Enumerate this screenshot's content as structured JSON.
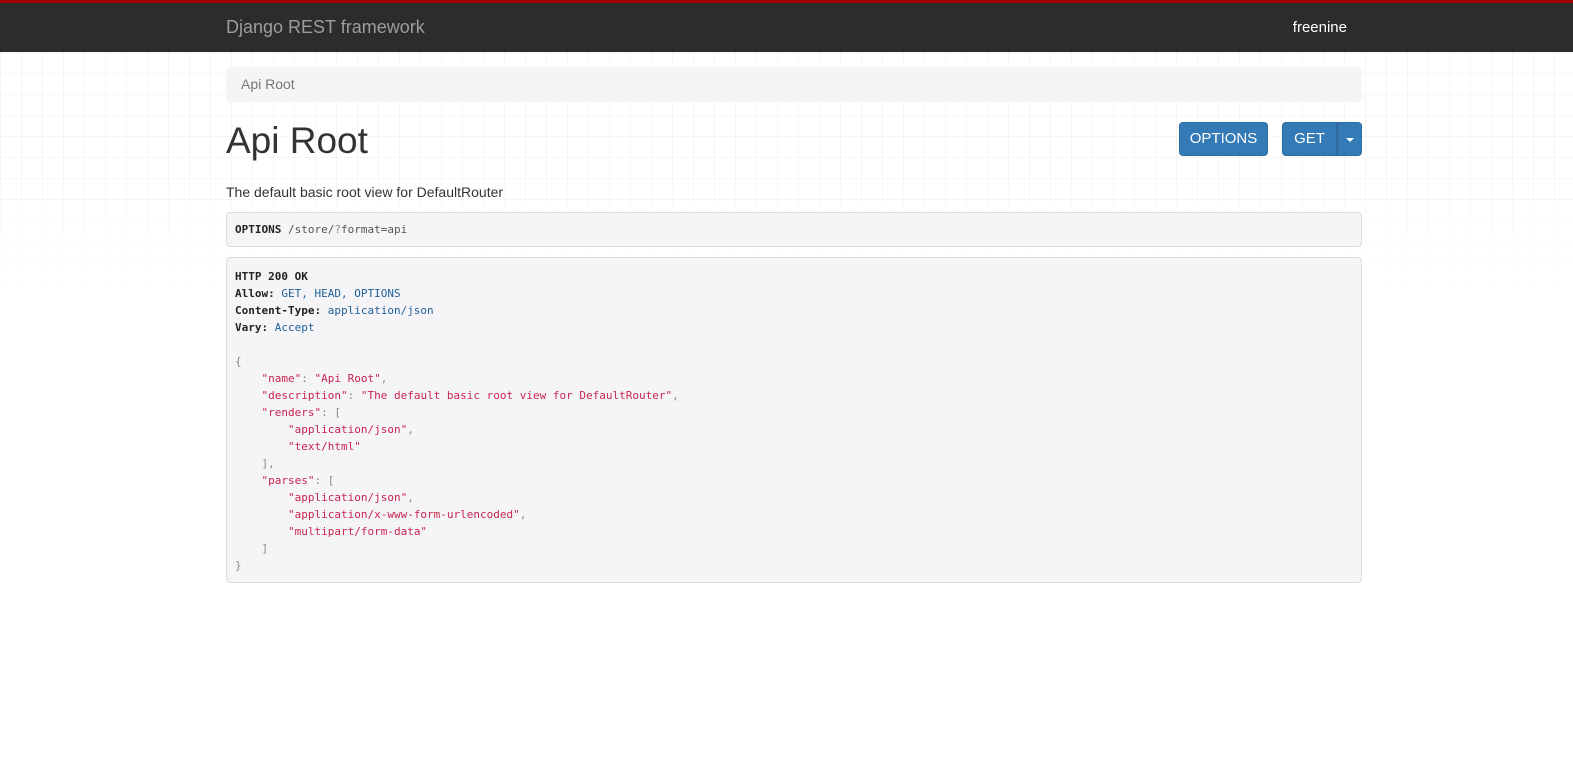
{
  "navbar": {
    "brand": "Django REST framework",
    "user": "freenine"
  },
  "breadcrumb": {
    "current": "Api Root"
  },
  "page": {
    "title": "Api Root",
    "description": "The default basic root view for DefaultRouter"
  },
  "actions": {
    "options_label": "OPTIONS",
    "get_label": "GET"
  },
  "request": {
    "method": "OPTIONS",
    "path": "/store/",
    "query_sep": "?",
    "query": "format=api"
  },
  "response": {
    "status": "HTTP 200 OK",
    "headers": {
      "allow_key": "Allow:",
      "allow_value": "GET, HEAD, OPTIONS",
      "content_type_key": "Content-Type:",
      "content_type_value": "application/json",
      "vary_key": "Vary:",
      "vary_value": "Accept"
    },
    "body": {
      "name_key": "\"name\"",
      "name_value": "\"Api Root\"",
      "description_key": "\"description\"",
      "description_value": "\"The default basic root view for DefaultRouter\"",
      "renders_key": "\"renders\"",
      "renders": [
        "\"application/json\"",
        "\"text/html\""
      ],
      "parses_key": "\"parses\"",
      "parses": [
        "\"application/json\"",
        "\"application/x-www-form-urlencoded\"",
        "\"multipart/form-data\""
      ]
    }
  },
  "colors": {
    "navbar_bg": "#2c2c2c",
    "navbar_accent": "#a30000",
    "button_primary": "#337ab7",
    "json_string": "#c7254e",
    "header_value": "#1f5f99"
  }
}
